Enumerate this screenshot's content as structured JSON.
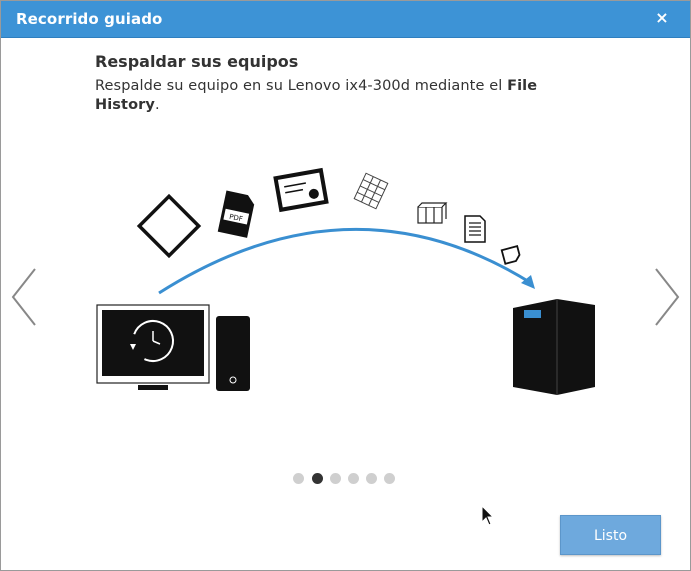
{
  "dialog": {
    "title": "Recorrido guiado",
    "close_symbol": "×"
  },
  "step": {
    "heading": "Respaldar sus equipos",
    "description_before": "Respalde su equipo en su Lenovo ix4-300d mediante el ",
    "description_bold": "File History",
    "description_after": "."
  },
  "illustration": {
    "pdf_label": "PDF",
    "icons": [
      "computer-monitor-icon",
      "clock-restore-icon",
      "pc-tower-icon",
      "nas-device-icon",
      "pdf-file-icon",
      "photo-frame-icon",
      "presentation-icon",
      "spreadsheet-icon",
      "archive-box-icon",
      "document-icon",
      "tag-icon"
    ]
  },
  "pagination": {
    "count": 6,
    "active_index": 1
  },
  "footer": {
    "done_label": "Listo"
  },
  "colors": {
    "titlebar": "#3d93d6",
    "arc": "#3a8fd1",
    "done_button": "#6ea9dd"
  }
}
